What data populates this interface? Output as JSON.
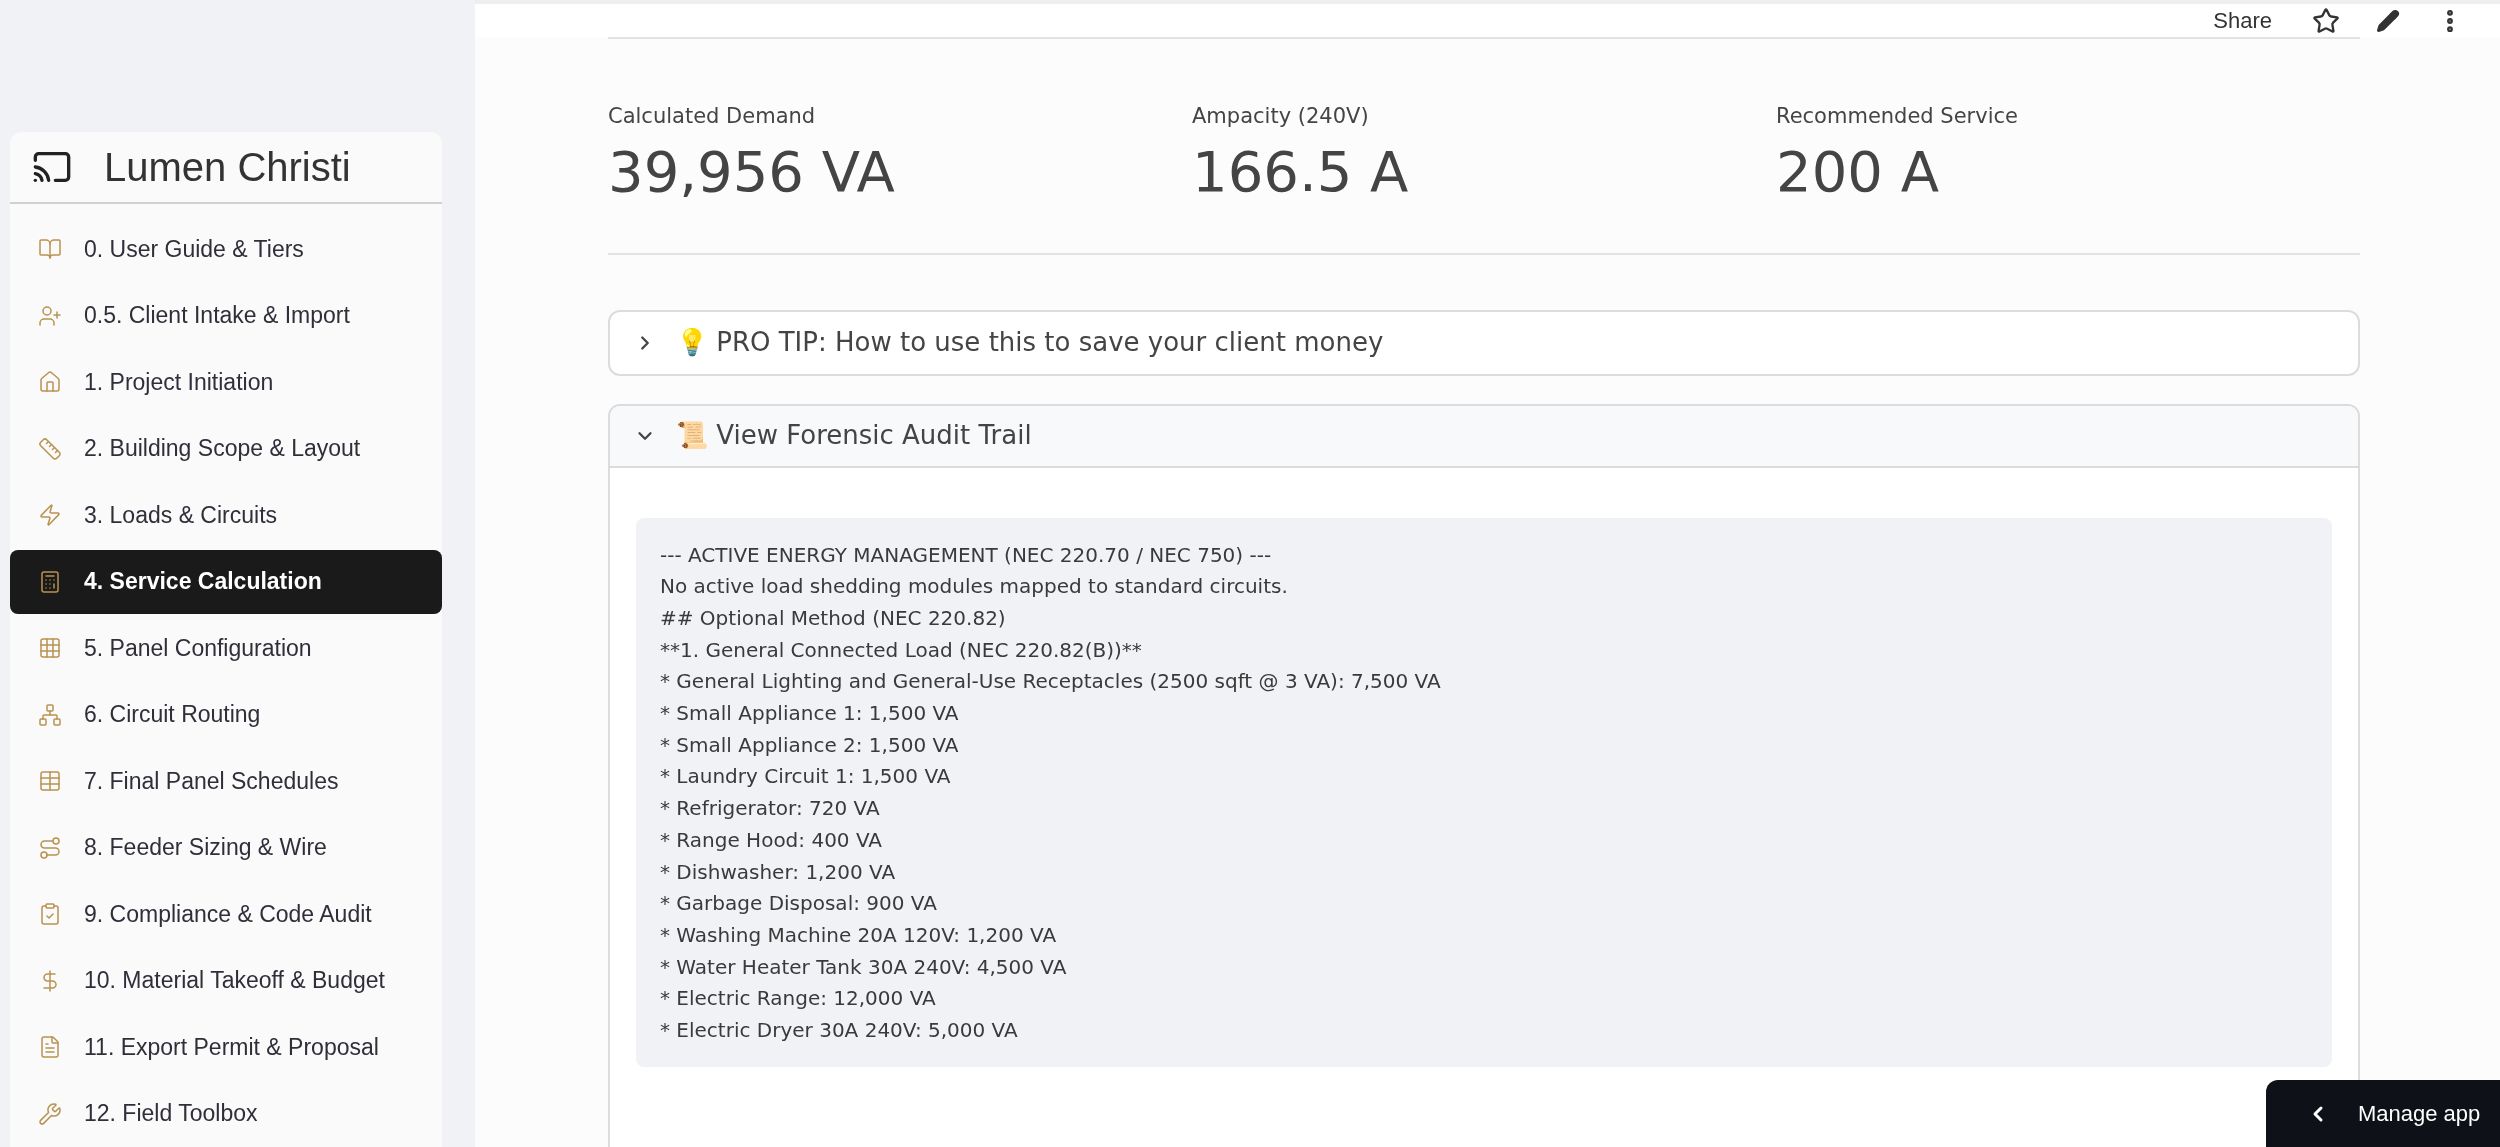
{
  "sidebar": {
    "title": "Lumen Christi",
    "items": [
      {
        "label": "0. User Guide & Tiers",
        "selected": false
      },
      {
        "label": "0.5. Client Intake & Import",
        "selected": false
      },
      {
        "label": "1. Project Initiation",
        "selected": false
      },
      {
        "label": "2. Building Scope & Layout",
        "selected": false
      },
      {
        "label": "3. Loads & Circuits",
        "selected": false
      },
      {
        "label": "4. Service Calculation",
        "selected": true
      },
      {
        "label": "5. Panel Configuration",
        "selected": false
      },
      {
        "label": "6. Circuit Routing",
        "selected": false
      },
      {
        "label": "7. Final Panel Schedules",
        "selected": false
      },
      {
        "label": "8. Feeder Sizing & Wire",
        "selected": false
      },
      {
        "label": "9. Compliance & Code Audit",
        "selected": false
      },
      {
        "label": "10. Material Takeoff & Budget",
        "selected": false
      },
      {
        "label": "11. Export Permit & Proposal",
        "selected": false
      },
      {
        "label": "12. Field Toolbox",
        "selected": false
      }
    ]
  },
  "header": {
    "share": "Share"
  },
  "metrics": [
    {
      "label": "Calculated Demand",
      "value": "39,956 VA"
    },
    {
      "label": "Ampacity (240V)",
      "value": "166.5 A"
    },
    {
      "label": "Recommended Service",
      "value": "200 A"
    }
  ],
  "expanders": [
    {
      "label": "💡 PRO TIP: How to use this to save your client money",
      "expanded": false
    },
    {
      "label": "📜 View Forensic Audit Trail",
      "expanded": true,
      "lines": [
        "--- ACTIVE ENERGY MANAGEMENT (NEC 220.70 / NEC 750) ---",
        "No active load shedding modules mapped to standard circuits.",
        "## Optional Method (NEC 220.82)",
        "**1. General Connected Load (NEC 220.82(B))**",
        "* General Lighting and General-Use Receptacles (2500 sqft @ 3 VA): 7,500 VA",
        "* Small Appliance 1: 1,500 VA",
        "* Small Appliance 2: 1,500 VA",
        "* Laundry Circuit 1: 1,500 VA",
        "* Refrigerator: 720 VA",
        "* Range Hood: 400 VA",
        "* Dishwasher: 1,200 VA",
        "* Garbage Disposal: 900 VA",
        "* Washing Machine 20A 120V: 1,200 VA",
        "* Water Heater Tank 30A 240V: 4,500 VA",
        "* Electric Range: 12,000 VA",
        "* Electric Dryer 30A 240V: 5,000 VA"
      ]
    }
  ],
  "manage_app": "Manage app"
}
